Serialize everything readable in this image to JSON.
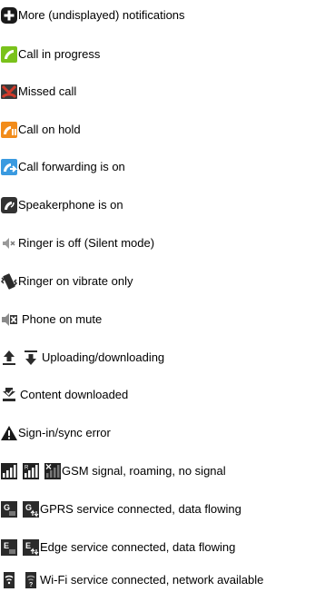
{
  "items": [
    {
      "label": "More (undisplayed) notifications",
      "icons": [
        "more-notifications-icon"
      ]
    },
    {
      "label": "Call in progress",
      "icons": [
        "call-in-progress-icon"
      ]
    },
    {
      "label": "Missed call",
      "icons": [
        "missed-call-icon"
      ]
    },
    {
      "label": "Call on hold",
      "icons": [
        "call-on-hold-icon"
      ]
    },
    {
      "label": "Call forwarding is on",
      "icons": [
        "call-forwarding-icon"
      ]
    },
    {
      "label": "Speakerphone is on",
      "icons": [
        "speakerphone-icon"
      ]
    },
    {
      "label": "Ringer is off (Silent mode)",
      "icons": [
        "ringer-off-icon"
      ]
    },
    {
      "label": "Ringer on vibrate only",
      "icons": [
        "vibrate-icon"
      ]
    },
    {
      "label": "Phone on mute",
      "icons": [
        "phone-mute-icon"
      ]
    },
    {
      "label": "Uploading/downloading",
      "icons": [
        "uploading-icon",
        "downloading-icon"
      ]
    },
    {
      "label": "Content downloaded",
      "icons": [
        "content-downloaded-icon"
      ]
    },
    {
      "label": "Sign-in/sync error",
      "icons": [
        "sync-error-icon"
      ]
    },
    {
      "label": "GSM signal, roaming, no signal",
      "icons": [
        "gsm-signal-icon",
        "roaming-signal-icon",
        "no-signal-icon"
      ]
    },
    {
      "label": "GPRS service connected, data flowing",
      "icons": [
        "gprs-connected-icon",
        "gprs-data-flowing-icon"
      ]
    },
    {
      "label": "Edge service connected, data flowing",
      "icons": [
        "edge-connected-icon",
        "edge-data-flowing-icon"
      ]
    },
    {
      "label": "Wi-Fi service connected, network available",
      "icons": [
        "wifi-connected-icon",
        "wifi-available-icon"
      ]
    }
  ],
  "colors": {
    "green": "#7ac21b",
    "orange": "#f28c1a",
    "blue": "#3a9ae0",
    "red": "#d23a2a",
    "dark": "#2b2b2b",
    "gray": "#7a7a7a"
  }
}
